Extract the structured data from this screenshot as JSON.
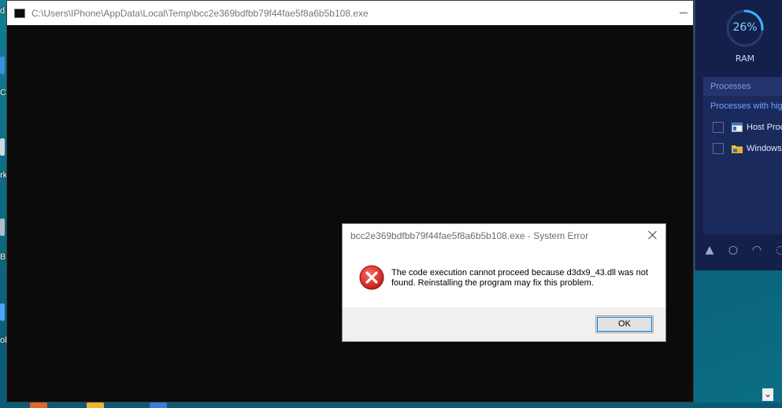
{
  "console": {
    "title": "C:\\Users\\IPhone\\AppData\\Local\\Temp\\bcc2e369bdfbb79f44fae5f8a6b5b108.exe"
  },
  "desktop": {
    "labels": [
      "d",
      "C",
      "rk",
      "Bi",
      "ol"
    ]
  },
  "optimizer": {
    "ram_percent_text": "26%",
    "ram_fraction": 0.26,
    "ram_label": "RAM",
    "processes_header": "Processes",
    "processes_sub": "Processes with high",
    "items": [
      {
        "label": "Host Proc",
        "icon": "window-app-icon"
      },
      {
        "label": "Windows",
        "icon": "folder-icon"
      }
    ],
    "accent": "#3ab4ff"
  },
  "dialog": {
    "title": "bcc2e369bdfbb79f44fae5f8a6b5b108.exe - System Error",
    "message": "The code execution cannot proceed because d3dx9_43.dll was not found. Reinstalling the program may fix this problem.",
    "ok_label": "OK",
    "icon": "error-icon"
  }
}
